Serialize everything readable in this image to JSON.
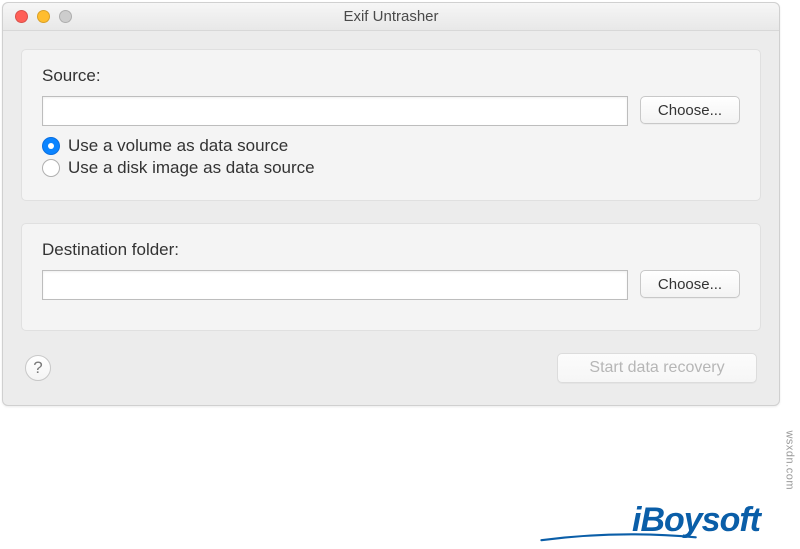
{
  "window": {
    "title": "Exif Untrasher"
  },
  "source_panel": {
    "label": "Source:",
    "input_value": "",
    "choose_label": "Choose...",
    "radio_volume": "Use a volume as data source",
    "radio_image": "Use a disk image as data source"
  },
  "dest_panel": {
    "label": "Destination folder:",
    "input_value": "",
    "choose_label": "Choose..."
  },
  "footer": {
    "help_glyph": "?",
    "start_label": "Start data recovery"
  },
  "watermark": {
    "text": "iBoysoft",
    "side": "wsxdn.com"
  }
}
